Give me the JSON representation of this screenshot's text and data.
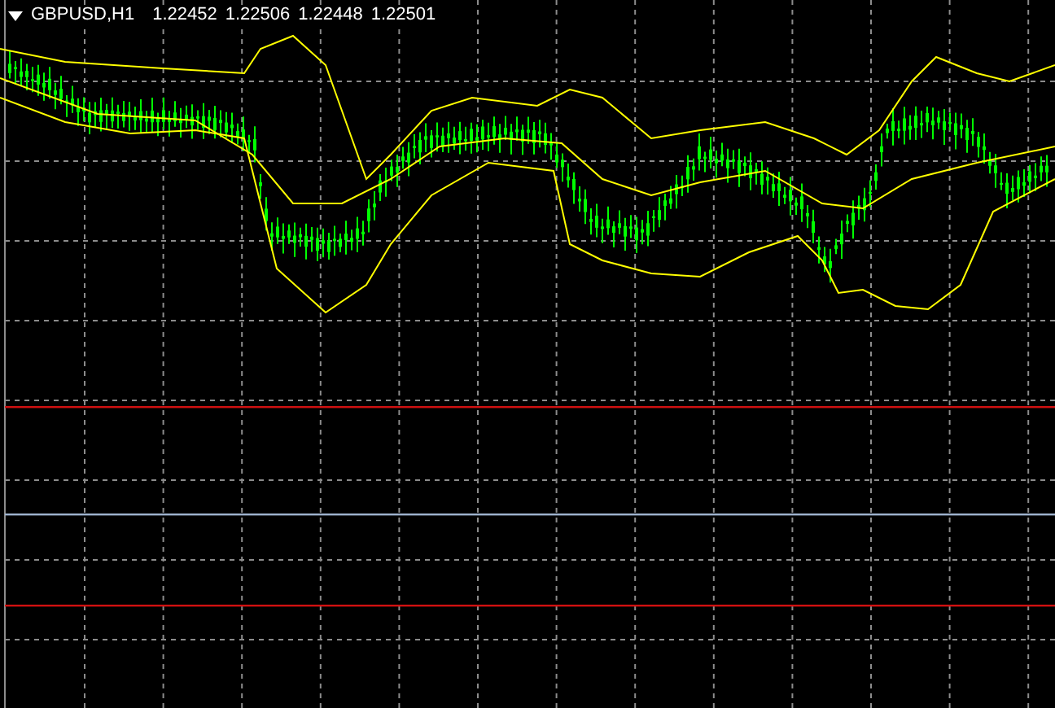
{
  "chart_header": {
    "symbol": "GBPUSD,H1",
    "quotes": [
      "1.22452",
      "1.22506",
      "1.22448",
      "1.22501"
    ]
  },
  "levels": [
    {
      "color": "#d01010"
    },
    {
      "color": "#9fb3cf"
    },
    {
      "color": "#d01010"
    }
  ]
}
